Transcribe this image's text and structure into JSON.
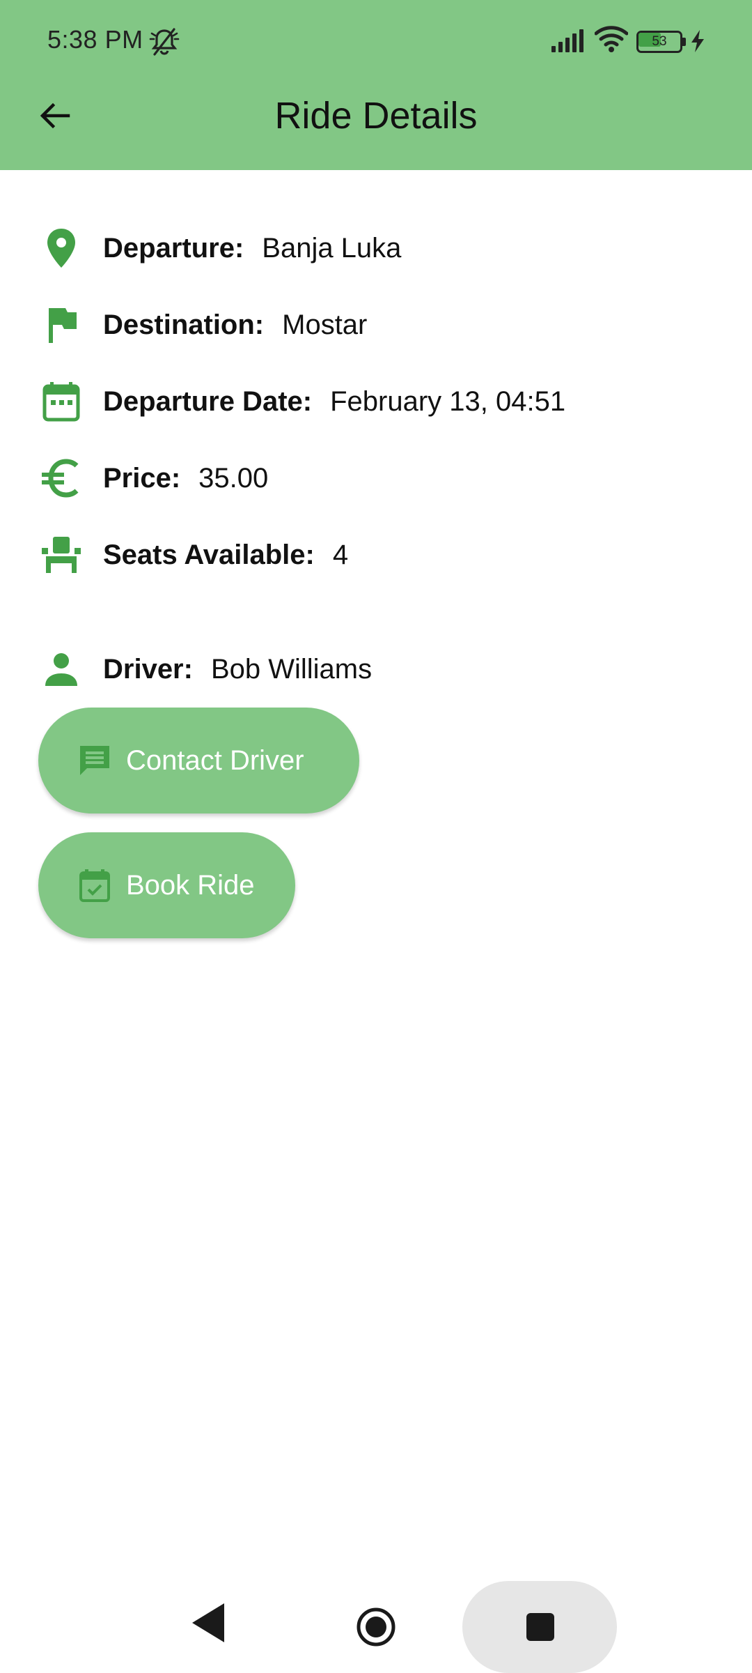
{
  "status_bar": {
    "time": "5:38 PM",
    "battery_level": "53",
    "battery_fraction": 0.53,
    "icons": [
      "bell-off-icon",
      "signal-icon",
      "wifi-icon",
      "battery-icon",
      "charging-bolt-icon"
    ]
  },
  "app_bar": {
    "title": "Ride Details",
    "back_icon": "arrow-back-icon"
  },
  "details": [
    {
      "icon": "location-pin-icon",
      "label": "Departure:",
      "value": "Banja Luka"
    },
    {
      "icon": "flag-icon",
      "label": "Destination:",
      "value": "Mostar"
    },
    {
      "icon": "calendar-icon",
      "label": "Departure Date:",
      "value": "February 13, 04:51"
    },
    {
      "icon": "euro-icon",
      "label": "Price:",
      "value": "35.00"
    },
    {
      "icon": "seat-icon",
      "label": "Seats Available:",
      "value": "4"
    },
    {
      "icon": "person-icon",
      "label": "Driver:",
      "value": "Bob Williams"
    }
  ],
  "actions": {
    "contact_driver": {
      "label": "Contact Driver",
      "icon": "message-icon"
    },
    "book_ride": {
      "label": "Book Ride",
      "icon": "calendar-check-icon"
    }
  },
  "nav_bar": {
    "icons": [
      "nav-back-icon",
      "nav-home-icon",
      "nav-recents-icon"
    ]
  },
  "colors": {
    "header": "#82c785",
    "icon_accent": "#43a047",
    "button": "#82c785",
    "button_text": "#ffffff"
  }
}
